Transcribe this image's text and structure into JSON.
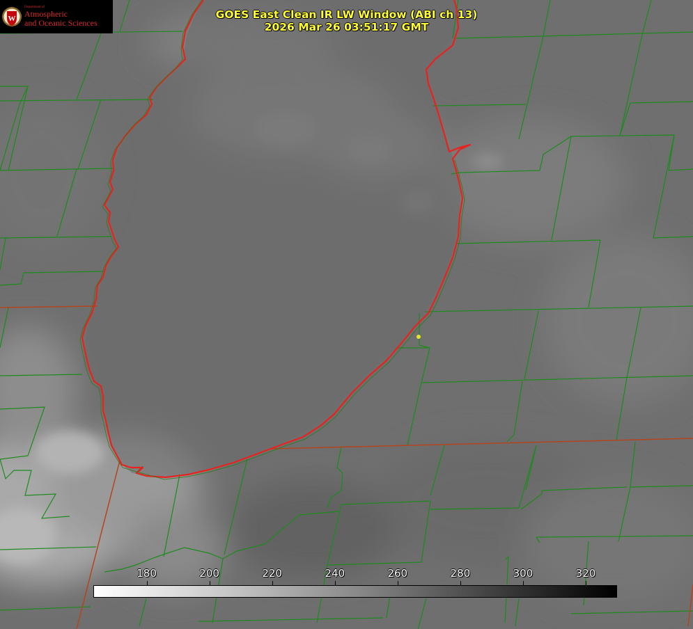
{
  "header": {
    "title_line1": "GOES East Clean IR LW Window (ABI ch 13)",
    "title_line2": "2026 Mar 26 03:51:17 GMT"
  },
  "logo": {
    "department": "Department of",
    "line1": "Atmospheric",
    "line2": "and Oceanic Sciences",
    "seal_letter": "W"
  },
  "colorbar": {
    "ticks": [
      "180",
      "200",
      "220",
      "240",
      "260",
      "280",
      "300",
      "320"
    ],
    "tick_values": [
      180,
      200,
      220,
      240,
      260,
      280,
      300,
      320
    ],
    "range": [
      163,
      330
    ],
    "scale": "white (cold) to black (warm)"
  },
  "colors": {
    "title": "#ffff33",
    "coastline": "#e8221f",
    "county_lines": "#1d8a1d",
    "state_lines": "#b2451e",
    "station_marker": "#e5e52a"
  }
}
